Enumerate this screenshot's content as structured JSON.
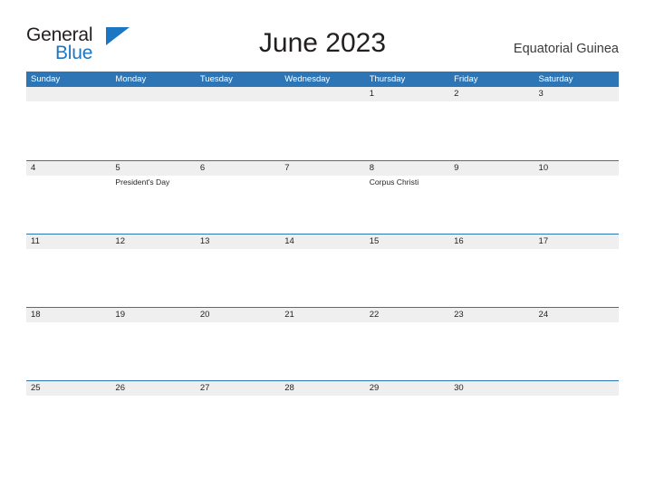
{
  "brand": {
    "name_part1": "General",
    "name_part2": "Blue",
    "accent_color": "#1b77c4",
    "flag_icon": "triangle-flag-icon"
  },
  "header": {
    "title": "June 2023",
    "country": "Equatorial Guinea"
  },
  "colors": {
    "header_blue": "#2e75b6",
    "row_band_gray": "#efefef",
    "text_dark": "#231f20",
    "link_blue": "#1b77c4"
  },
  "calendar": {
    "weekdays": [
      "Sunday",
      "Monday",
      "Tuesday",
      "Wednesday",
      "Thursday",
      "Friday",
      "Saturday"
    ],
    "weeks": [
      [
        {
          "day": "",
          "events": []
        },
        {
          "day": "",
          "events": []
        },
        {
          "day": "",
          "events": []
        },
        {
          "day": "",
          "events": []
        },
        {
          "day": "1",
          "events": []
        },
        {
          "day": "2",
          "events": []
        },
        {
          "day": "3",
          "events": []
        }
      ],
      [
        {
          "day": "4",
          "events": []
        },
        {
          "day": "5",
          "events": [
            "President's Day"
          ]
        },
        {
          "day": "6",
          "events": []
        },
        {
          "day": "7",
          "events": []
        },
        {
          "day": "8",
          "events": [
            "Corpus Christi"
          ]
        },
        {
          "day": "9",
          "events": []
        },
        {
          "day": "10",
          "events": []
        }
      ],
      [
        {
          "day": "11",
          "events": []
        },
        {
          "day": "12",
          "events": []
        },
        {
          "day": "13",
          "events": []
        },
        {
          "day": "14",
          "events": []
        },
        {
          "day": "15",
          "events": []
        },
        {
          "day": "16",
          "events": []
        },
        {
          "day": "17",
          "events": []
        }
      ],
      [
        {
          "day": "18",
          "events": []
        },
        {
          "day": "19",
          "events": []
        },
        {
          "day": "20",
          "events": []
        },
        {
          "day": "21",
          "events": []
        },
        {
          "day": "22",
          "events": []
        },
        {
          "day": "23",
          "events": []
        },
        {
          "day": "24",
          "events": []
        }
      ],
      [
        {
          "day": "25",
          "events": []
        },
        {
          "day": "26",
          "events": []
        },
        {
          "day": "27",
          "events": []
        },
        {
          "day": "28",
          "events": []
        },
        {
          "day": "29",
          "events": []
        },
        {
          "day": "30",
          "events": []
        },
        {
          "day": "",
          "events": []
        }
      ]
    ]
  }
}
